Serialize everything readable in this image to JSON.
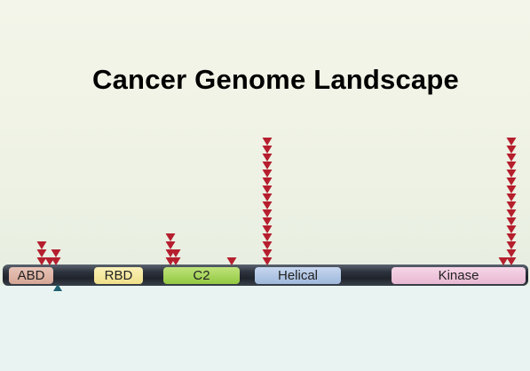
{
  "title": "Cancer Genome Landscape",
  "colors": {
    "mutation": "#b51f2e",
    "below_marker": "#1f5f70"
  },
  "domains": [
    {
      "label": "ABD"
    },
    {
      "label": "RBD"
    },
    {
      "label": "C2"
    },
    {
      "label": "Helical"
    },
    {
      "label": "Kinase"
    }
  ]
}
